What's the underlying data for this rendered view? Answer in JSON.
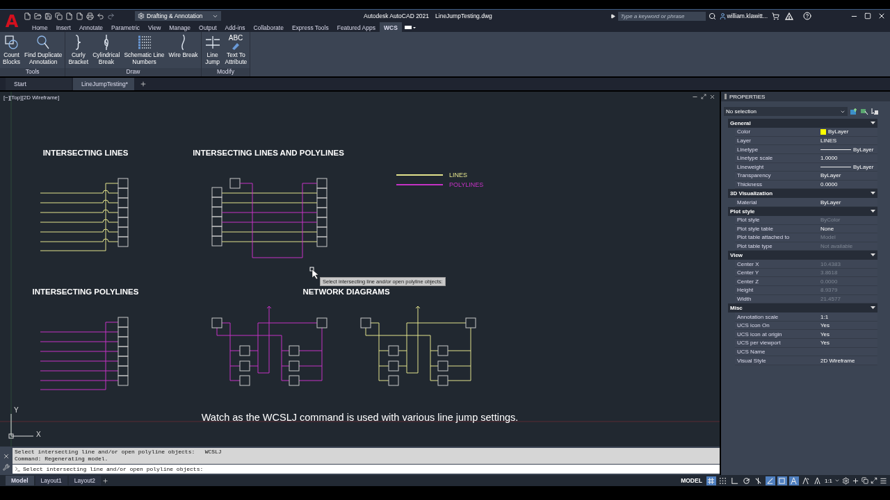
{
  "title_bar": {
    "logo": "A",
    "workspace": "Drafting & Annotation",
    "app_title": "Autodesk AutoCAD 2021",
    "file_title": "LineJumpTesting.dwg",
    "search": {
      "placeholder": "Type a keyword or phrase"
    },
    "user": "william.klawitt..."
  },
  "ribbon_tabs": [
    {
      "label": "Home",
      "selected": false
    },
    {
      "label": "Insert",
      "selected": false
    },
    {
      "label": "Annotate",
      "selected": false
    },
    {
      "label": "Parametric",
      "selected": false
    },
    {
      "label": "View",
      "selected": false
    },
    {
      "label": "Manage",
      "selected": false
    },
    {
      "label": "Output",
      "selected": false
    },
    {
      "label": "Add-ins",
      "selected": false
    },
    {
      "label": "Collaborate",
      "selected": false
    },
    {
      "label": "Express Tools",
      "selected": false
    },
    {
      "label": "Featured Apps",
      "selected": false
    },
    {
      "label": "WCS",
      "selected": true
    }
  ],
  "ribbon_panels": [
    {
      "label": "Tools",
      "buttons": [
        {
          "kind": "count",
          "label": "Count\nBlocks"
        },
        {
          "kind": "duplicate",
          "label": "Find Duplicate\nAnnotation"
        }
      ]
    },
    {
      "label": "Draw",
      "buttons": [
        {
          "kind": "bracket",
          "label": "Curly\nBracket"
        },
        {
          "kind": "break",
          "label": "Cylindrical\nBreak"
        },
        {
          "kind": "numbers",
          "label": "Schematic Line\nNumbers"
        },
        {
          "kind": "wire",
          "label": "Wire Break"
        }
      ]
    },
    {
      "label": "Modify",
      "buttons": [
        {
          "kind": "jump",
          "label": "Line\nJump"
        },
        {
          "kind": "attribute",
          "label": "Text To\nAttribute",
          "icon_text": "ABC"
        }
      ]
    }
  ],
  "file_tabs": [
    {
      "label": "Start",
      "selected": false
    },
    {
      "label": "LineJumpTesting*",
      "selected": true
    }
  ],
  "viewport": {
    "label": "[−][Top][2D Wireframe]",
    "drawings": [
      {
        "kind": "lines",
        "title": "INTERSECTING LINES"
      },
      {
        "kind": "mixed",
        "title": "INTERSECTING LINES AND POLYLINES"
      },
      {
        "kind": "polylines",
        "title": "INTERSECTING POLYLINES"
      },
      {
        "kind": "network",
        "title": "NETWORK DIAGRAMS"
      }
    ],
    "legend": [
      {
        "label": "LINES",
        "color": "#e3e38c"
      },
      {
        "label": "POLYLINES",
        "color": "#c532c5"
      }
    ],
    "tooltip": "Select intersecting line and/or open polyline objects:",
    "caption": "Watch as the WCSLJ command is used with various line jump settings.",
    "ucs": {
      "x": "X",
      "y": "Y"
    }
  },
  "properties": {
    "title": "PROPERTIES",
    "selection": "No selection",
    "sections": [
      {
        "title": "General",
        "expanded": true,
        "rows": [
          {
            "label": "Color",
            "value": "ByLayer",
            "kind": "swatch",
            "color": "#ffff00",
            "disabled": false
          },
          {
            "label": "Layer",
            "value": "LINES",
            "kind": "text",
            "disabled": false
          },
          {
            "label": "Linetype",
            "value": "ByLayer",
            "kind": "line",
            "disabled": false
          },
          {
            "label": "Linetype scale",
            "value": "1.0000",
            "kind": "text",
            "disabled": false
          },
          {
            "label": "Lineweight",
            "value": "ByLayer",
            "kind": "line",
            "disabled": false
          },
          {
            "label": "Transparency",
            "value": "ByLayer",
            "kind": "text",
            "disabled": false
          },
          {
            "label": "Thickness",
            "value": "0.0000",
            "kind": "text",
            "disabled": false
          }
        ]
      },
      {
        "title": "3D Visualization",
        "expanded": true,
        "rows": [
          {
            "label": "Material",
            "value": "ByLayer",
            "kind": "text",
            "disabled": false
          }
        ]
      },
      {
        "title": "Plot style",
        "expanded": true,
        "rows": [
          {
            "label": "Plot style",
            "value": "ByColor",
            "kind": "text",
            "disabled": true
          },
          {
            "label": "Plot style table",
            "value": "None",
            "kind": "text",
            "disabled": false
          },
          {
            "label": "Plot table attached to",
            "value": "Model",
            "kind": "text",
            "disabled": true
          },
          {
            "label": "Plot table type",
            "value": "Not available",
            "kind": "text",
            "disabled": true
          }
        ]
      },
      {
        "title": "View",
        "expanded": true,
        "rows": [
          {
            "label": "Center X",
            "value": "10.4383",
            "kind": "text",
            "disabled": true
          },
          {
            "label": "Center Y",
            "value": "3.8618",
            "kind": "text",
            "disabled": true
          },
          {
            "label": "Center Z",
            "value": "0.0000",
            "kind": "text",
            "disabled": true
          },
          {
            "label": "Height",
            "value": "8.9379",
            "kind": "text",
            "disabled": true
          },
          {
            "label": "Width",
            "value": "21.4577",
            "kind": "text",
            "disabled": true
          }
        ]
      },
      {
        "title": "Misc",
        "expanded": true,
        "rows": [
          {
            "label": "Annotation scale",
            "value": "1:1",
            "kind": "text",
            "disabled": false
          },
          {
            "label": "UCS icon On",
            "value": "Yes",
            "kind": "text",
            "disabled": false
          },
          {
            "label": "UCS icon at origin",
            "value": "Yes",
            "kind": "text",
            "disabled": false
          },
          {
            "label": "UCS per viewport",
            "value": "Yes",
            "kind": "text",
            "disabled": false
          },
          {
            "label": "UCS Name",
            "kind": "text"
          },
          {
            "label": "Visual Style",
            "value": "2D Wireframe",
            "kind": "text",
            "disabled": false
          }
        ]
      }
    ]
  },
  "command_line": {
    "history": [
      "Select intersecting line and/or open polyline objects:   WCSLJ",
      "Command: Regenerating model."
    ],
    "prompt": "Select intersecting line and/or open polyline objects:"
  },
  "layout_tabs": [
    {
      "label": "Model",
      "selected": true
    },
    {
      "label": "Layout1",
      "selected": false
    },
    {
      "label": "Layout2",
      "selected": false
    }
  ],
  "status_bar": {
    "mode": "MODEL",
    "scale": "1:1",
    "toggles": [
      {
        "kind": "grid",
        "on": true
      },
      {
        "kind": "snap",
        "on": false
      },
      {
        "kind": "ortho",
        "on": false
      },
      {
        "kind": "polar",
        "on": false
      },
      {
        "kind": "isodraft",
        "on": false
      },
      {
        "kind": "osnap",
        "on": true
      },
      {
        "kind": "selection",
        "on": true
      },
      {
        "kind": "annotation",
        "on": true
      },
      {
        "kind": "autoscale",
        "on": false
      },
      {
        "kind": "visibility",
        "on": false
      }
    ]
  }
}
